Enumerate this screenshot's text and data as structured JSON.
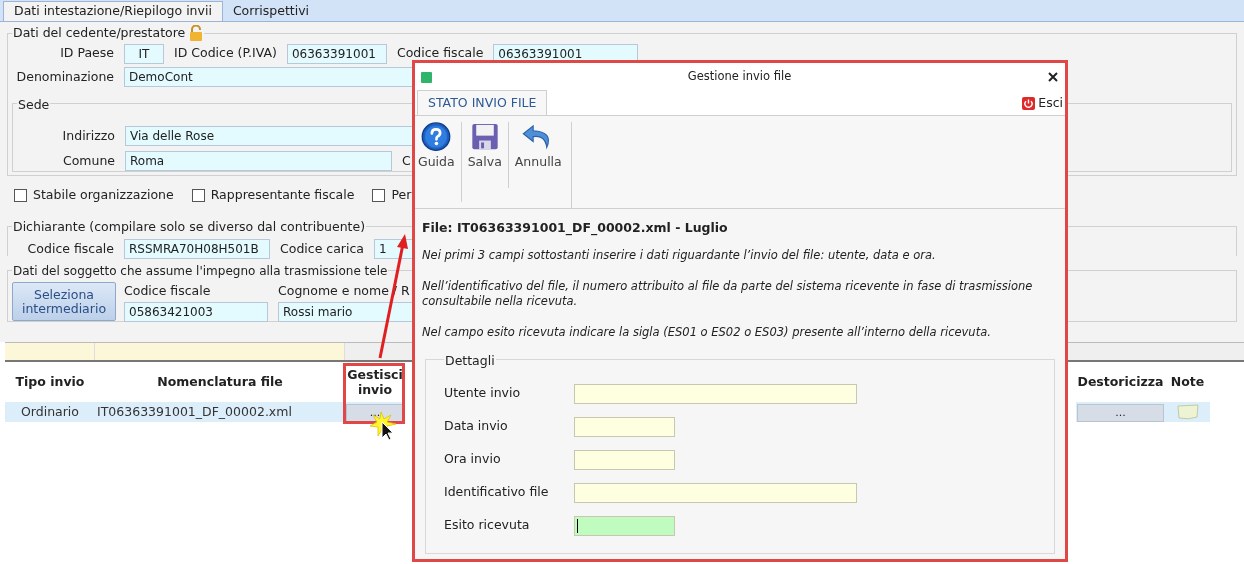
{
  "tabs": [
    {
      "label": "Dati intestazione/Riepilogo invii",
      "selected": true
    },
    {
      "label": "Corrispettivi",
      "selected": false
    }
  ],
  "cedente": {
    "legend": "Dati del cedente/prestatore",
    "id_paese_label": "ID Paese",
    "id_paese": "IT",
    "id_codice_label": "ID Codice (P.IVA)",
    "id_codice": "06363391001",
    "codice_fiscale_label": "Codice fiscale",
    "codice_fiscale": "06363391001",
    "denominazione_label": "Denominazione",
    "denominazione": "DemoCont"
  },
  "sede": {
    "legend": "Sede",
    "indirizzo_label": "Indirizzo",
    "indirizzo": "Via delle Rose",
    "comune_label": "Comune",
    "comune": "Roma",
    "cut_label": "C"
  },
  "checkboxes": [
    {
      "label": "Stabile organizzazione",
      "checked": false
    },
    {
      "label": "Rappresentante fiscale",
      "checked": false
    },
    {
      "label": "Per",
      "checked": false
    }
  ],
  "dichiarante": {
    "legend": "Dichiarante (compilare solo se diverso dal contribuente)",
    "codice_fiscale_label": "Codice fiscale",
    "codice_fiscale": "RSSMRA70H08H501B",
    "codice_carica_label": "Codice carica",
    "codice_carica": "1"
  },
  "intermediario": {
    "legend": "Dati del soggetto che assume l'impegno alla trasmissione tele",
    "button": "Seleziona intermediario",
    "codice_fiscale_label": "Codice fiscale",
    "codice_fiscale": "05863421003",
    "cognome_label": "Cognome e nome / R",
    "cognome": "Rossi mario"
  },
  "table": {
    "columns": [
      "Tipo invio",
      "Nomenclatura file",
      "Gestisci invio",
      "Destoricizza",
      "Note"
    ],
    "rows": [
      {
        "tipo_invio": "Ordinario",
        "nomenclatura_file": "IT06363391001_DF_00002.xml",
        "gestisci_invio": "...",
        "destoricizza": "..."
      }
    ]
  },
  "dialog": {
    "title": "Gestione invio file",
    "tabs": [
      {
        "label": "STATO INVIO FILE",
        "selected": true
      }
    ],
    "exit": "Esci",
    "toolbar": [
      {
        "kind": "help",
        "label": "Guida"
      },
      {
        "kind": "save",
        "label": "Salva"
      },
      {
        "kind": "undo",
        "label": "Annulla"
      }
    ],
    "file_title": "File: IT06363391001_DF_00002.xml - Luglio",
    "notes": [
      "Nei primi 3 campi sottostanti inserire i dati riguardante l’invio del file: utente, data e ora.",
      "Nell’identificativo del file, il numero attribuito al file da parte del sistema ricevente in fase di trasmissione consultabile nella ricevuta.",
      "Nel campo esito ricevuta indicare la sigla (ES01 o ES02 o ES03) presente all’interno della ricevuta."
    ],
    "details_legend": "Dettagli",
    "fields": [
      {
        "label": "Utente invio",
        "kind": "text",
        "focused": false
      },
      {
        "label": "Data invio",
        "kind": "date",
        "focused": false
      },
      {
        "label": "Ora invio",
        "kind": "time",
        "focused": false
      },
      {
        "label": "Identificativo file",
        "kind": "text",
        "focused": false
      },
      {
        "label": "Esito ricevuta",
        "kind": "code",
        "focused": true
      }
    ]
  }
}
